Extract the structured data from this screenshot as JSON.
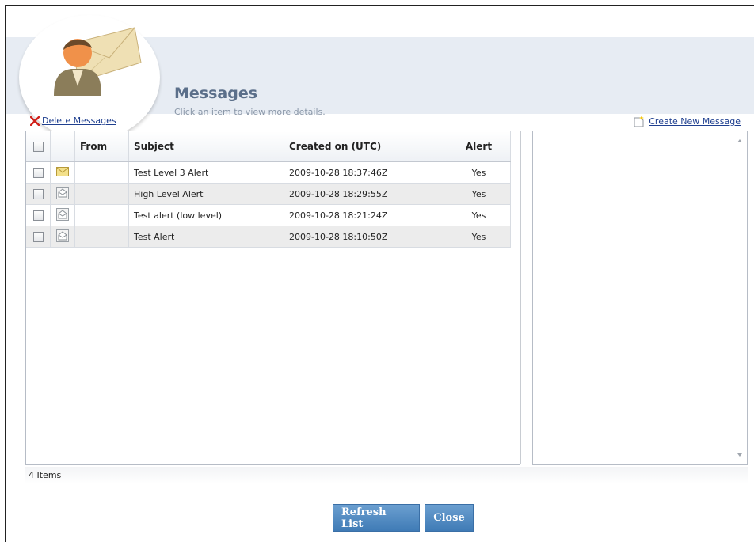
{
  "page": {
    "title": "Messages",
    "subtitle": "Click an item to view more details."
  },
  "actions": {
    "delete_label": "Delete Messages",
    "create_label": "Create New Message"
  },
  "table": {
    "columns": [
      "",
      "",
      "From",
      "Subject",
      "Created on (UTC)",
      "Alert"
    ],
    "rows": [
      {
        "icon": "unread-envelope-icon",
        "from": "",
        "subject": "Test Level 3 Alert",
        "created": "2009-10-28 18:37:46Z",
        "alert": "Yes"
      },
      {
        "icon": "read-envelope-icon",
        "from": "",
        "subject": "High Level Alert",
        "created": "2009-10-28 18:29:55Z",
        "alert": "Yes"
      },
      {
        "icon": "read-envelope-icon",
        "from": "",
        "subject": "Test alert (low level)",
        "created": "2009-10-28 18:21:24Z",
        "alert": "Yes"
      },
      {
        "icon": "read-envelope-icon",
        "from": "",
        "subject": "Test Alert",
        "created": "2009-10-28 18:10:50Z",
        "alert": "Yes"
      }
    ]
  },
  "status": {
    "items_label": "4 Items"
  },
  "buttons": {
    "refresh_label": "Refresh List",
    "close_label": "Close"
  },
  "colors": {
    "header_band": "#e7ecf3",
    "title": "#5b6f8a",
    "link": "#1f3f8f",
    "button": "#4a86c0",
    "delete_icon": "#d0201a"
  }
}
